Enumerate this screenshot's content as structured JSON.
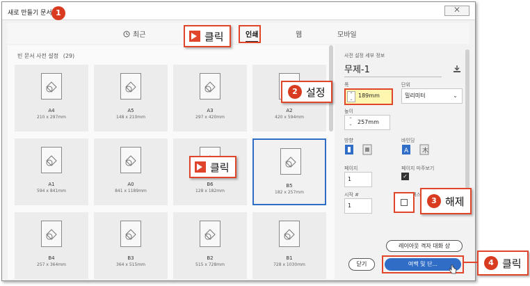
{
  "window": {
    "title": "새로 만들기 문서",
    "close_label": "⨉"
  },
  "tabs": [
    {
      "label": "최근"
    },
    {
      "label": "인쇄"
    },
    {
      "label": "웹"
    },
    {
      "label": "모바일"
    }
  ],
  "gallery": {
    "title": "빈 문서 사전 설정",
    "count": "(29)",
    "cards": [
      {
        "name": "A4",
        "size": "210 x 297mm"
      },
      {
        "name": "A5",
        "size": "148 x 210mm"
      },
      {
        "name": "A3",
        "size": "297 x 420mm"
      },
      {
        "name": "A2",
        "size": "420 x 594mm"
      },
      {
        "name": "A1",
        "size": "594 x 841mm"
      },
      {
        "name": "A0",
        "size": "841 x 1189mm"
      },
      {
        "name": "B6",
        "size": "128 x 182mm"
      },
      {
        "name": "B5",
        "size": "182 x 257mm"
      },
      {
        "name": "B4",
        "size": "257 x 364mm"
      },
      {
        "name": "B3",
        "size": "364 x 515mm"
      },
      {
        "name": "B2",
        "size": "515 x 728mm"
      },
      {
        "name": "B1",
        "size": "728 x 1030mm"
      }
    ]
  },
  "panel": {
    "header": "사전 설정 세부 정보",
    "doc_name": "무제-1",
    "width_label": "폭",
    "width_value": "189mm",
    "unit_label": "단위",
    "unit_value": "밀리미터",
    "height_label": "높이",
    "height_value": "257mm",
    "orientation_label": "방향",
    "binding_label": "바인딩",
    "pages_label": "페이지",
    "pages_value": "1",
    "facing_label": "페이지 마주보기",
    "start_label": "시작 #",
    "start_value": "1",
    "primary_text_label": "기본 텍스",
    "layout_grid_button": "레이아웃 격자 대화 상",
    "close_button": "닫기",
    "margins_button": "여백 및 단..."
  },
  "annotations": {
    "step1": "1",
    "step2": "2",
    "step3": "3",
    "step4": "4",
    "click": "클릭",
    "set": "설정",
    "release": "해제",
    "click_tab": "클릭",
    "click_card": "클릭"
  },
  "colors": {
    "accent": "#2f6dc7",
    "callout": "#e0442a",
    "highlight": "#fff7b0"
  }
}
